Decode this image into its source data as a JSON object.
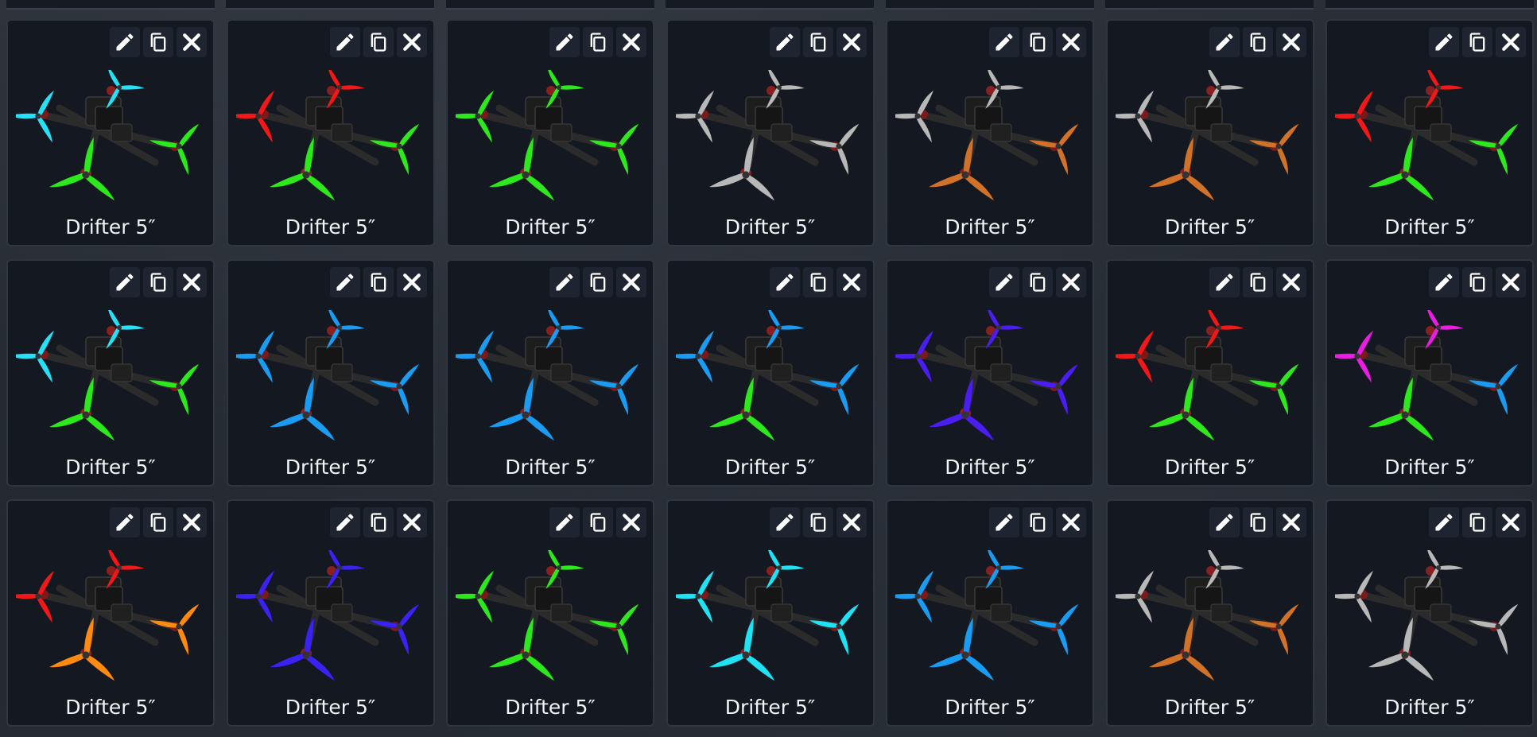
{
  "actions": {
    "edit_icon": "pencil-icon",
    "copy_icon": "copy-icon",
    "delete_icon": "close-icon"
  },
  "cards": [
    {
      "name": "Drifter 5″",
      "front_left": "#28e0f5",
      "front_right": "#2ee81e",
      "rear": "#2ee81e"
    },
    {
      "name": "Drifter 5″",
      "front_left": "#f01818",
      "front_right": "#2ee81e",
      "rear": "#2ee81e"
    },
    {
      "name": "Drifter 5″",
      "front_left": "#2ee81e",
      "front_right": "#2ee81e",
      "rear": "#2ee81e"
    },
    {
      "name": "Drifter 5″",
      "front_left": "#b8b8b8",
      "front_right": "#b8b8b8",
      "rear": "#b8b8b8"
    },
    {
      "name": "Drifter 5″",
      "front_left": "#b8b8b8",
      "front_right": "#d0722a",
      "rear": "#d0722a"
    },
    {
      "name": "Drifter 5″",
      "front_left": "#b8b8b8",
      "front_right": "#d0722a",
      "rear": "#d0722a"
    },
    {
      "name": "Drifter 5″",
      "front_left": "#f01818",
      "front_right": "#2ee81e",
      "rear": "#2ee81e"
    },
    {
      "name": "Drifter 5″",
      "front_left": "#28e0f5",
      "front_right": "#2ee81e",
      "rear": "#2ee81e"
    },
    {
      "name": "Drifter 5″",
      "front_left": "#1a9cf2",
      "front_right": "#1a9cf2",
      "rear": "#1a9cf2"
    },
    {
      "name": "Drifter 5″",
      "front_left": "#1a9cf2",
      "front_right": "#1a9cf2",
      "rear": "#1a9cf2"
    },
    {
      "name": "Drifter 5″",
      "front_left": "#1a9cf2",
      "front_right": "#1a9cf2",
      "rear": "#2ee81e"
    },
    {
      "name": "Drifter 5″",
      "front_left": "#4b1ef0",
      "front_right": "#4b1ef0",
      "rear": "#4b1ef0"
    },
    {
      "name": "Drifter 5″",
      "front_left": "#f01818",
      "front_right": "#2ee81e",
      "rear": "#2ee81e"
    },
    {
      "name": "Drifter 5″",
      "front_left": "#e81ee0",
      "front_right": "#1a9cf2",
      "rear": "#2ee81e"
    },
    {
      "name": "Drifter 5″",
      "front_left": "#f01818",
      "front_right": "#ff8a12",
      "rear": "#ff8a12"
    },
    {
      "name": "Drifter 5″",
      "front_left": "#3a22f0",
      "front_right": "#3a22f0",
      "rear": "#3a22f0"
    },
    {
      "name": "Drifter 5″",
      "front_left": "#2ee81e",
      "front_right": "#2ee81e",
      "rear": "#2ee81e"
    },
    {
      "name": "Drifter 5″",
      "front_left": "#1fe2f5",
      "front_right": "#1fe2f5",
      "rear": "#1fe2f5"
    },
    {
      "name": "Drifter 5″",
      "front_left": "#1a9cf2",
      "front_right": "#1a9cf2",
      "rear": "#1a9cf2"
    },
    {
      "name": "Drifter 5″",
      "front_left": "#b8b8b8",
      "front_right": "#d0722a",
      "rear": "#d0722a"
    },
    {
      "name": "Drifter 5″",
      "front_left": "#b8b8b8",
      "front_right": "#b8b8b8",
      "rear": "#b8b8b8"
    }
  ]
}
